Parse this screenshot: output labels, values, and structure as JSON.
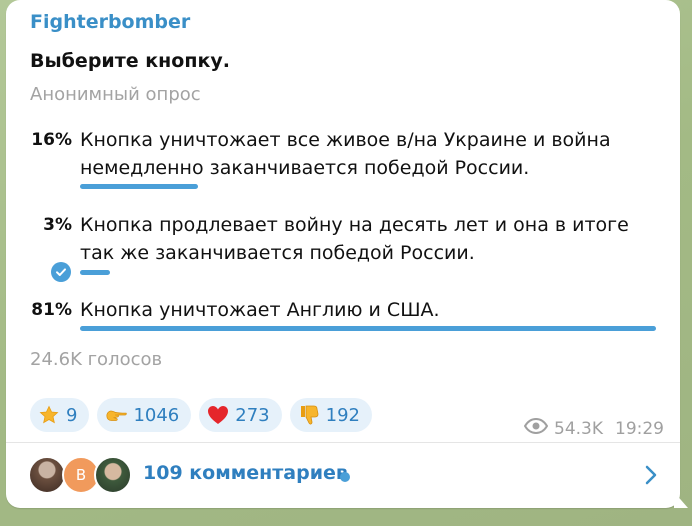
{
  "message": {
    "author": "Fighterbomber",
    "question": "Выберите кнопку.",
    "poll_type": "Анонимный опрос",
    "options": [
      {
        "percent": "16%",
        "text": "Кнопка уничтожает все живое в/на Украине и война немедленно заканчивается победой России.",
        "share": 0.16,
        "chosen": false
      },
      {
        "percent": "3%",
        "text": "Кнопка продлевает войну на десять лет и она в итоге так же заканчивается победой России.",
        "share": 0.03,
        "chosen": true
      },
      {
        "percent": "81%",
        "text": "Кнопка уничтожает Англию и США.",
        "share": 0.81,
        "chosen": false
      }
    ],
    "votes": "24.6K голосов",
    "reactions": [
      {
        "icon": "star-icon",
        "count": "9"
      },
      {
        "icon": "pointing-hand-icon",
        "count": "1046"
      },
      {
        "icon": "red-heart-icon",
        "count": "273"
      },
      {
        "icon": "thumbs-down-icon",
        "count": "192"
      }
    ],
    "views": "54.3K",
    "time": "19:29",
    "comments": {
      "avatar_letter": "B",
      "label": "109 комментариев"
    }
  },
  "colors": {
    "accent": "#4a9fd8",
    "author": "#3a8fc7",
    "chat_background": "#a9be8d"
  }
}
